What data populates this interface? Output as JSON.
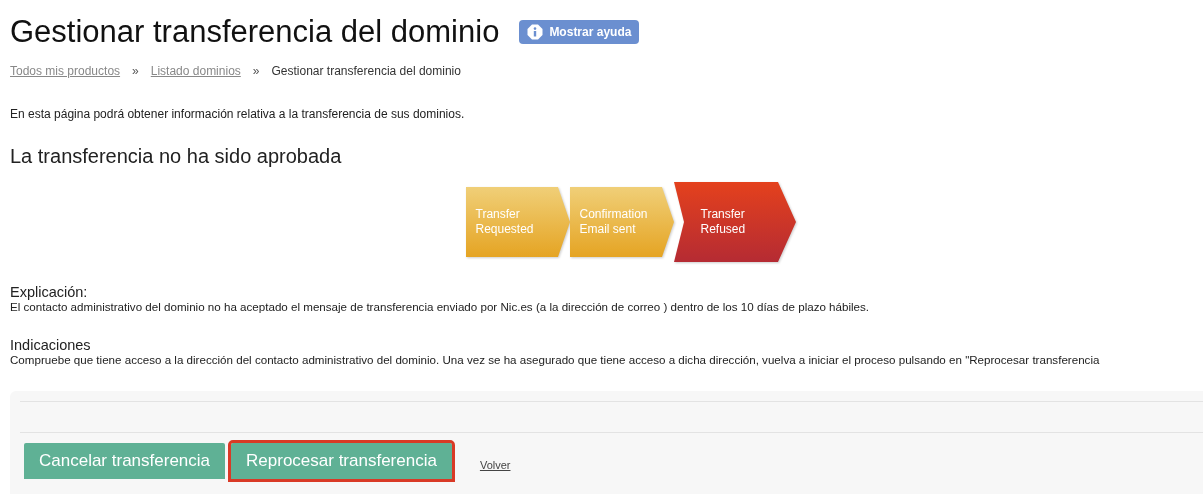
{
  "title": "Gestionar transferencia del dominio",
  "help_button": {
    "label": "Mostrar ayuda"
  },
  "breadcrumb": [
    {
      "label": "Todos mis productos",
      "link": true
    },
    {
      "label": "»",
      "link": false
    },
    {
      "label": "Listado dominios",
      "link": true
    },
    {
      "label": "»",
      "link": false
    },
    {
      "label": "Gestionar transferencia del dominio",
      "link": false
    }
  ],
  "intro": "En esta página podrá obtener información relativa a la transferencia de sus dominios.",
  "status_heading": "La transferencia no ha sido aprobada",
  "steps": [
    {
      "line1": "Transfer",
      "line2": "Requested",
      "refused": false
    },
    {
      "line1": "Confirmation",
      "line2": "Email sent",
      "refused": false
    },
    {
      "line1": "Transfer",
      "line2": "Refused",
      "refused": true
    }
  ],
  "sections": [
    {
      "heading": "Explicación:",
      "text": "El contacto administrativo del dominio no ha aceptado el mensaje de transferencia enviado por Nic.es (a la dirección de correo ) dentro de los 10 días de plazo hábiles."
    },
    {
      "heading": "Indicaciones",
      "text": "Compruebe que tiene acceso a la dirección del contacto administrativo del dominio. Una vez se ha asegurado que tiene acceso a dicha dirección, vuelva a iniciar el proceso pulsando en \"Reprocesar transferencia"
    }
  ],
  "buttons": [
    {
      "label": "Cancelar transferencia",
      "highlighted": false
    },
    {
      "label": "Reprocesar transferencia",
      "highlighted": true
    }
  ],
  "back_link": "Volver"
}
